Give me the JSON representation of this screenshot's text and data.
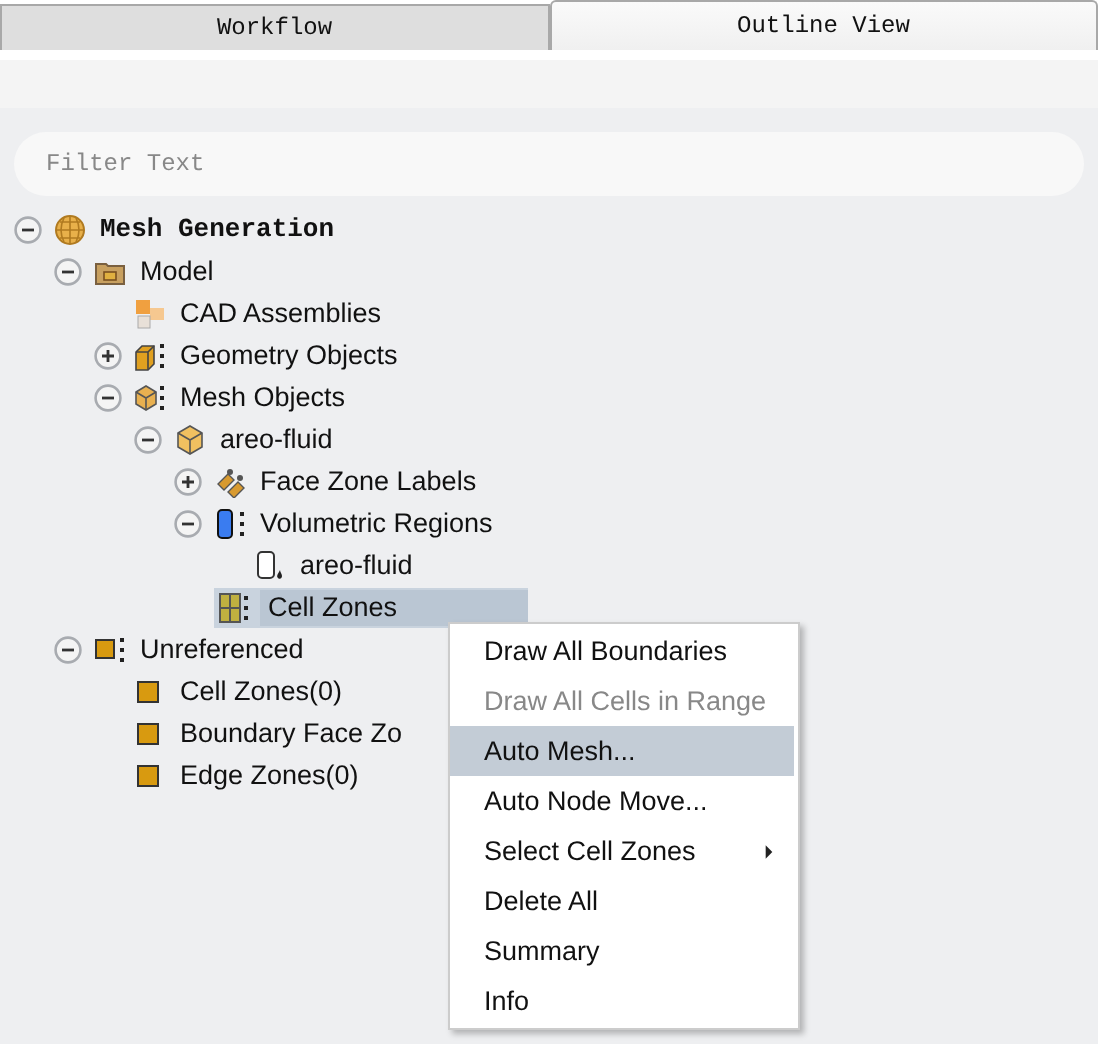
{
  "tabs": [
    {
      "label": "Workflow",
      "selected": false
    },
    {
      "label": "Outline View",
      "selected": true
    }
  ],
  "filter": {
    "placeholder": "Filter Text"
  },
  "tree": [
    {
      "label": "Mesh Generation",
      "kind": "root",
      "expanded": true,
      "selected": false,
      "children": [
        {
          "label": "Model",
          "kind": "folder",
          "expanded": true,
          "selected": false,
          "children": [
            {
              "label": "CAD Assemblies",
              "kind": "cad",
              "selected": false
            },
            {
              "label": "Geometry Objects",
              "kind": "geometry",
              "expanded": false,
              "selected": false
            },
            {
              "label": "Mesh Objects",
              "kind": "mesh",
              "expanded": true,
              "selected": false,
              "children": [
                {
                  "label": "areo-fluid",
                  "kind": "cube",
                  "expanded": true,
                  "selected": false,
                  "children": [
                    {
                      "label": "Face Zone Labels",
                      "kind": "tags",
                      "expanded": false,
                      "selected": false
                    },
                    {
                      "label": "Volumetric Regions",
                      "kind": "cylinder",
                      "expanded": true,
                      "selected": false,
                      "children": [
                        {
                          "label": "areo-fluid",
                          "kind": "region",
                          "selected": false
                        }
                      ]
                    },
                    {
                      "label": "Cell Zones",
                      "kind": "cells",
                      "selected": true
                    }
                  ]
                }
              ]
            }
          ]
        },
        {
          "label": "Unreferenced",
          "kind": "group",
          "expanded": true,
          "selected": false,
          "children": [
            {
              "label": "Cell Zones(0)",
              "kind": "square",
              "selected": false
            },
            {
              "label": "Boundary Face Zo",
              "kind": "square",
              "selected": false
            },
            {
              "label": "Edge Zones(0)",
              "kind": "square",
              "selected": false
            }
          ]
        }
      ]
    }
  ],
  "context_menu": [
    {
      "label": "Draw All Boundaries",
      "disabled": false,
      "selected": false
    },
    {
      "label": "Draw All Cells in Range",
      "disabled": true,
      "selected": false
    },
    {
      "label": "Auto Mesh...",
      "disabled": false,
      "selected": true
    },
    {
      "label": "Auto Node Move...",
      "disabled": false,
      "selected": false
    },
    {
      "label": "Select Cell Zones",
      "disabled": false,
      "selected": false,
      "submenu": true
    },
    {
      "label": "Delete All",
      "disabled": false,
      "selected": false
    },
    {
      "label": "Summary",
      "disabled": false,
      "selected": false
    },
    {
      "label": "Info",
      "disabled": false,
      "selected": false
    }
  ]
}
